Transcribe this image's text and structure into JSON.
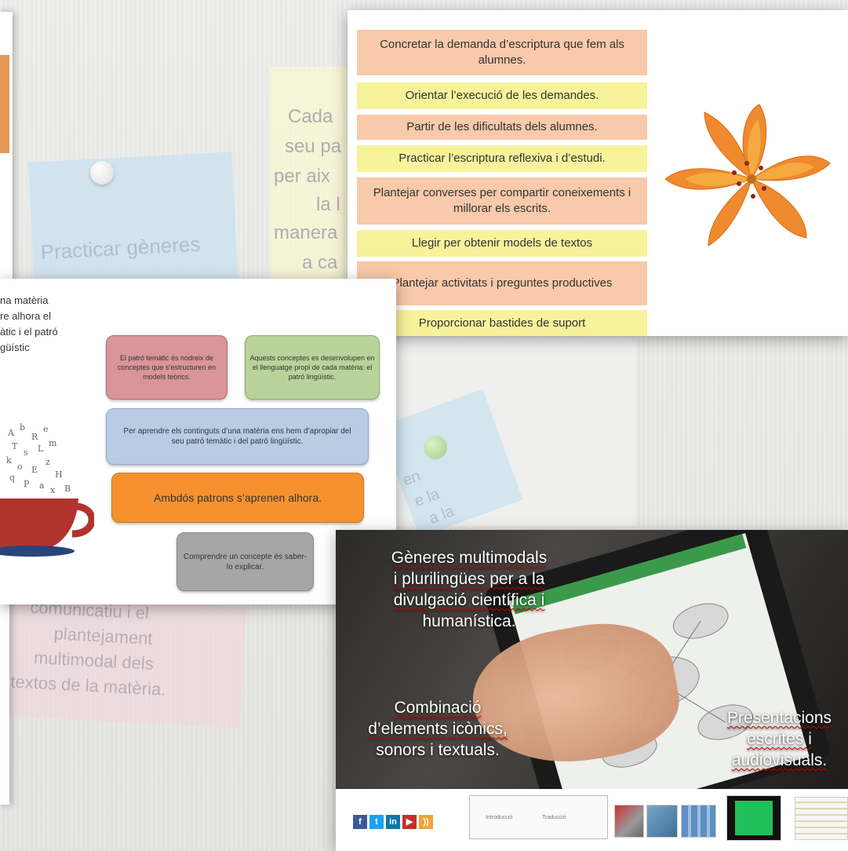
{
  "background": {
    "note_blue_top": "Practicar gèneres",
    "note_yellow_lines": [
      "Cada",
      "seu pa",
      "per aix",
      "la l",
      "manera",
      "a ca"
    ],
    "note_blue_mid_lines": [
      "en",
      "e la",
      "a la"
    ],
    "note_pink_lines": [
      "comunicatiu i el",
      "plantejament",
      "multimodal dels",
      "textos de la matèria."
    ]
  },
  "slide1": {
    "items": [
      {
        "text": "Concretar la demanda d’escriptura que fem als alumnes.",
        "color": "peach"
      },
      {
        "text": "Orientar l’execució de les demandes.",
        "color": "yellow"
      },
      {
        "text": "Partir de les dificultats dels alumnes.",
        "color": "peach"
      },
      {
        "text": "Practicar l’escriptura reflexiva i d’estudi.",
        "color": "yellow"
      },
      {
        "text": "Plantejar converses per compartir coneixements i millorar els escrits.",
        "color": "peach"
      },
      {
        "text": "Llegir per obtenir models de textos",
        "color": "yellow"
      },
      {
        "text": "Plantejar activitats i preguntes productives",
        "color": "peach"
      },
      {
        "text": "Proporcionar bastides de suport",
        "color": "yellow"
      }
    ],
    "image": "lily-flower"
  },
  "slide2": {
    "intro_lines": [
      "na matèria",
      "re alhora el",
      "àtic i el patró",
      "güístic"
    ],
    "box_red": "El patró temàtic és nodreix de conceptes que s’estructuren en models teòrics.",
    "box_green": "Aquests conceptes es desenvolupen en el llenguatge propi de cada matèria: el patró lingüístic.",
    "box_blue": "Per aprendre els continguts d’una matèria ens hem d’apropiar del seu patró temàtic i del patró lingüístic.",
    "box_orange": "Ambdós patrons s’aprenen alhora.",
    "box_gray": "Comprendre un concepte és saber-lo explicar.",
    "image": "cup-with-letters"
  },
  "slide3": {
    "text_top": [
      "Gèneres multimodals",
      "i plurilingües per a la",
      "divulgació científica i",
      "humanística."
    ],
    "text_bottom_left": [
      "Combinació",
      "d’elements icònics,",
      "sonors i textuals."
    ],
    "text_bottom_right": [
      "Presentacions",
      "escrites i",
      "audiovisuals."
    ],
    "social_icons": [
      "facebook-icon",
      "twitter-icon",
      "linkedin-icon",
      "youtube-icon",
      "rss-icon"
    ],
    "mini_doc": {
      "left_label": "Introducció",
      "right_label": "Traducció"
    }
  }
}
